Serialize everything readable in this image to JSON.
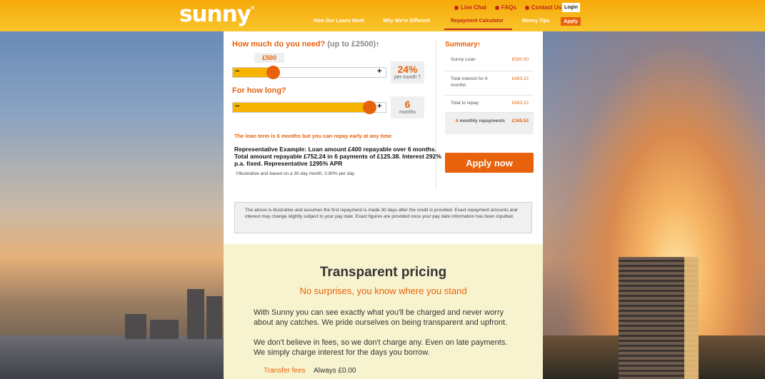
{
  "brand": {
    "logo": "sunny",
    "accent": "#e8620b",
    "header_color": "#f8b80c",
    "link_red": "#c3241b"
  },
  "header": {
    "top_links": [
      "Live Chat",
      "FAQs",
      "Contact Us"
    ],
    "login": "Login",
    "nav": [
      "How Our Loans Work",
      "Why We're Different",
      "Repayment Calculator",
      "Money Tips"
    ],
    "active_nav": "Repayment Calculator",
    "apply": "Apply"
  },
  "calculator": {
    "amount_question": "How much do you need?",
    "amount_limit": "(up to £2500)",
    "dagger": "†",
    "amount_value": "£500",
    "amount_fraction": 0.11,
    "minus": "−",
    "plus": "+",
    "rate_value": "24%",
    "rate_label": "per month †",
    "term_question": "For how long?",
    "term_fraction": 1.0,
    "term_value": "6",
    "term_unit": "months",
    "term_note": "The loan term is 6 months but you can repay early at any time",
    "representative": "Representative Example: Loan amount £400 repayable over 6 months. Total amount repayable £752.24 in 6 payments of £125.38. Interest 292% p.a. fixed. Representative 1295% APR",
    "illustrative": "†Illustrative and based on a 30 day month, 0.80% per day"
  },
  "summary": {
    "title": "Summary",
    "dagger": "†",
    "rows": [
      {
        "label": "Sunny Loan",
        "value": "£500.00"
      },
      {
        "label": "Total interest for 6 months",
        "value": "£493.23"
      },
      {
        "label": "Total to repay",
        "value": "£993.23"
      }
    ],
    "monthly_count": "6",
    "monthly_label": "monthly repayments",
    "monthly_value": "£165.53",
    "apply_now": "Apply now"
  },
  "disclaimer": "The above is illustrative and assumes the first repayment is made 30 days after the credit is provided. Exact repayment amounts and interest may change slightly subject to your pay date. Exact figures are provided once your pay date information has been inputted.",
  "pricing": {
    "title": "Transparent pricing",
    "subtitle": "No surprises, you know where you stand",
    "para1": "With Sunny you can see exactly what you'll be charged and never worry about any catches. We pride ourselves on being transparent and upfront.",
    "para2": "We don't believe in fees, so we don't charge any. Even on late payments. We simply charge interest for the days you borrow.",
    "fee_label": "Transfer fees",
    "fee_value": "Always £0.00"
  }
}
